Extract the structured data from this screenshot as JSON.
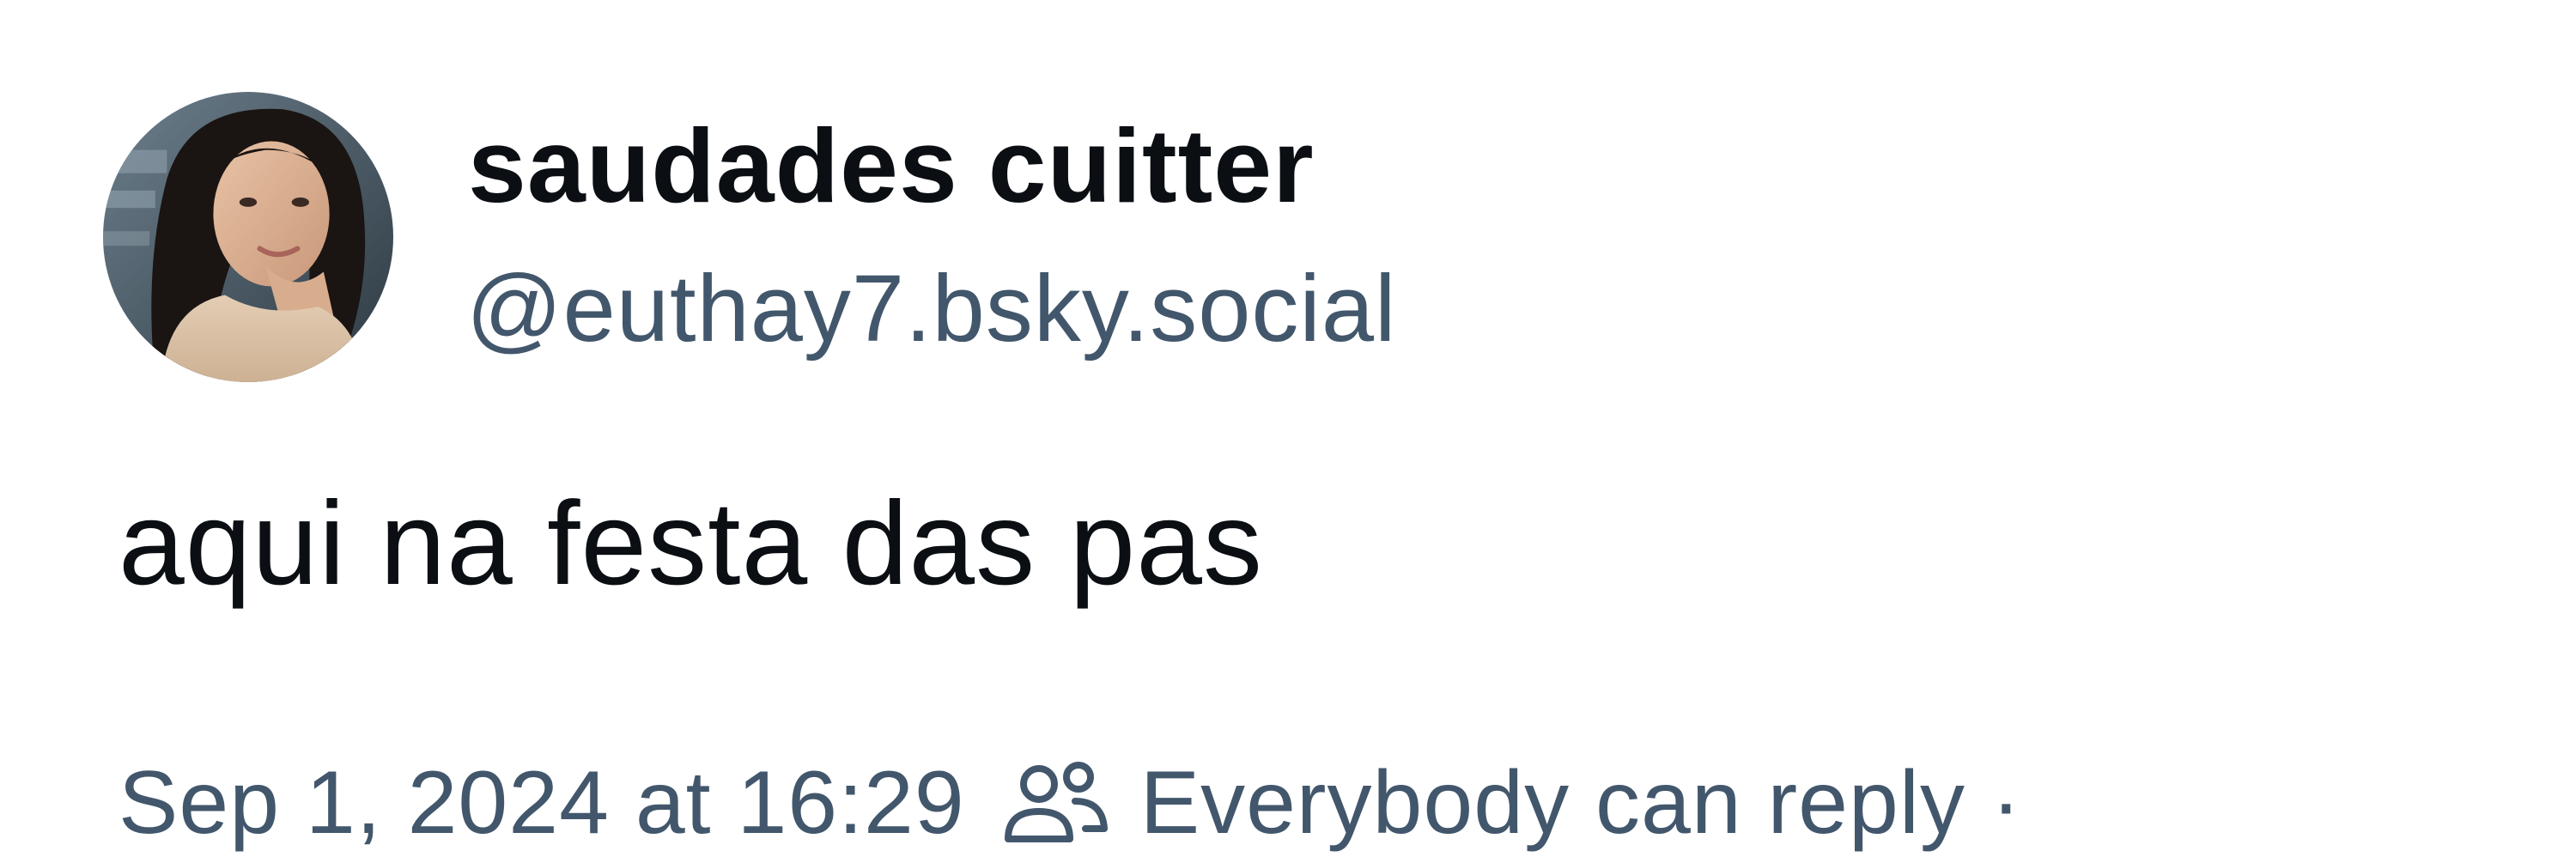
{
  "post": {
    "author": {
      "display_name": "saudades cuitter",
      "handle": "@euthay7.bsky.social",
      "avatar_icon": "profile-photo"
    },
    "text": "aqui na festa das pas",
    "timestamp": "Sep 1, 2024 at 16:29",
    "reply_icon": "people-icon",
    "reply_setting": "Everybody can reply",
    "separator": "·"
  },
  "colors": {
    "primary_text": "#0b0f14",
    "secondary_text": "#42576c",
    "background": "#ffffff"
  }
}
